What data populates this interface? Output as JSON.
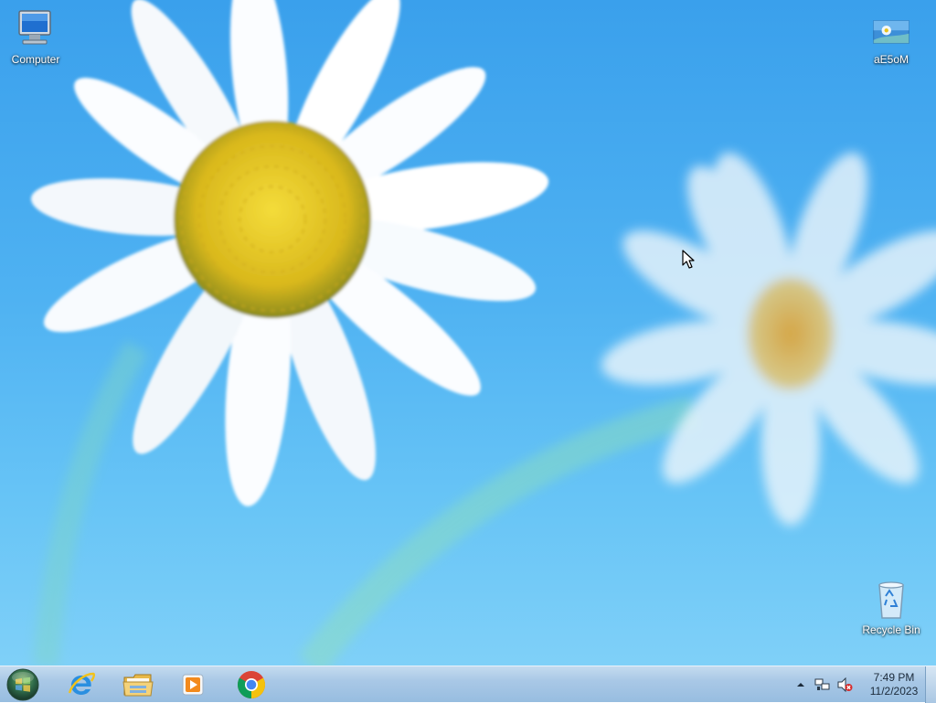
{
  "desktop": {
    "icons": {
      "computer": {
        "label": "Computer",
        "icon": "computer-icon"
      },
      "ae5om": {
        "label": "aE5oM",
        "icon": "image-file-icon"
      },
      "recycle_bin": {
        "label": "Recycle Bin",
        "icon": "recycle-bin-icon"
      }
    }
  },
  "taskbar": {
    "start": {
      "icon": "windows-orb-icon"
    },
    "pinned": [
      {
        "name": "Internet Explorer",
        "icon": "internet-explorer-icon"
      },
      {
        "name": "File Explorer",
        "icon": "folder-icon"
      },
      {
        "name": "Media Player",
        "icon": "media-player-icon"
      },
      {
        "name": "Google Chrome",
        "icon": "chrome-icon"
      }
    ],
    "tray": {
      "icons": [
        "show-hidden-icons-arrow",
        "network-icon",
        "volume-muted-icon"
      ],
      "time": "7:49 PM",
      "date": "11/2/2023"
    }
  },
  "colors": {
    "sky_top": "#3aa0ec",
    "sky_bottom": "#7fd0f8",
    "taskbar": "#a9c8e6",
    "flower_center": "#e6c21e"
  }
}
